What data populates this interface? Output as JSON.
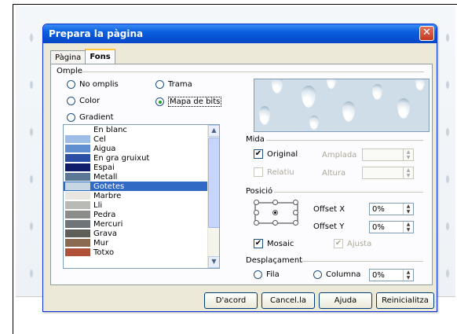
{
  "dialog": {
    "title": "Prepara la pàgina",
    "close_glyph": "✕"
  },
  "tabs": [
    {
      "label": "Pàgina",
      "active": false
    },
    {
      "label": "Fons",
      "active": true
    }
  ],
  "fill": {
    "group_label": "Omple",
    "options": [
      {
        "label": "No omplis",
        "selected": false
      },
      {
        "label": "Trama",
        "selected": false
      },
      {
        "label": "Color",
        "selected": false
      },
      {
        "label": "Mapa de bits",
        "selected": true
      },
      {
        "label": "Gradient",
        "selected": false
      }
    ]
  },
  "bitmaps": {
    "items": [
      {
        "label": "En blanc",
        "swatch": "#ffffff"
      },
      {
        "label": "Cel",
        "swatch": "#9dbde6"
      },
      {
        "label": "Aigua",
        "swatch": "#5f8fd0"
      },
      {
        "label": "En gra gruixut",
        "swatch": "#2b4fa5"
      },
      {
        "label": "Espai",
        "swatch": "#0e1c6a"
      },
      {
        "label": "Metall",
        "swatch": "#5b7796"
      },
      {
        "label": "Gotetes",
        "swatch": "#c7d6e3"
      },
      {
        "label": "Marbre",
        "swatch": "#e9e6e1"
      },
      {
        "label": "Lli",
        "swatch": "#b9bab5"
      },
      {
        "label": "Pedra",
        "swatch": "#8a8d8a"
      },
      {
        "label": "Mercuri",
        "swatch": "#6f7478"
      },
      {
        "label": "Grava",
        "swatch": "#5c5e57"
      },
      {
        "label": "Mur",
        "swatch": "#8a6a50"
      },
      {
        "label": "Totxo",
        "swatch": "#b0523a"
      }
    ],
    "selected": "Gotetes"
  },
  "size": {
    "group_label": "Mida",
    "original_label": "Original",
    "original_checked": true,
    "relative_label": "Relatiu",
    "relative_checked": false,
    "width_label": "Amplada",
    "height_label": "Altura"
  },
  "position": {
    "group_label": "Posició",
    "offset_x_label": "Offset X",
    "offset_x_value": "0%",
    "offset_y_label": "Offset Y",
    "offset_y_value": "0%",
    "tile_label": "Mosaic",
    "tile_checked": true,
    "fit_label": "Ajusta",
    "fit_checked": true
  },
  "displacement": {
    "group_label": "Desplaçament",
    "row_label": "Fila",
    "column_label": "Columna",
    "value": "0%"
  },
  "buttons": {
    "ok": "D'acord",
    "cancel": "Cancel.la",
    "help": "Ajuda",
    "reset": "Reinicialitza"
  }
}
